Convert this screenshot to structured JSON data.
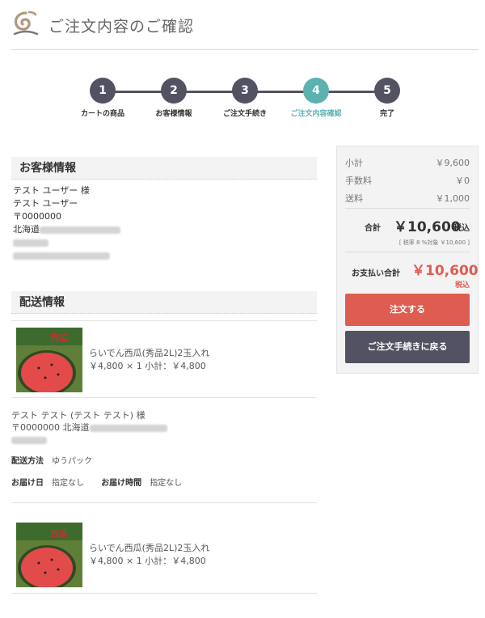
{
  "header": {
    "title": "ご注文内容のご確認"
  },
  "flow": {
    "steps": [
      {
        "num": "1",
        "label": "カートの商品"
      },
      {
        "num": "2",
        "label": "お客様情報"
      },
      {
        "num": "3",
        "label": "ご注文手続き"
      },
      {
        "num": "4",
        "label": "ご注文内容確認"
      },
      {
        "num": "5",
        "label": "完了"
      }
    ],
    "active_step": "4"
  },
  "customer": {
    "heading": "お客様情報",
    "name_kanji": "テスト ユーザー 様",
    "name_kana": "テスト ユーザー",
    "postal": "〒0000000",
    "prefecture": "北海道"
  },
  "shipping": {
    "heading": "配送情報",
    "items": [
      {
        "name": "らいでん西瓜(秀品2L)2玉入れ",
        "price_line": "￥4,800 × 1  小計：￥4,800"
      },
      {
        "name": "らいでん西瓜(秀品2L)2玉入れ",
        "price_line": "￥4,800 × 1  小計：￥4,800"
      }
    ],
    "recipient": "テスト テスト (テスト テスト) 様",
    "address": "〒0000000 北海道",
    "method_label": "配送方法",
    "method_value": "ゆうパック",
    "date_label": "お届け日",
    "date_value": "指定なし",
    "time_label": "お届け時間",
    "time_value": "指定なし"
  },
  "summary": {
    "subtotal_label": "小計",
    "subtotal_value": "￥9,600",
    "fee_label": "手数料",
    "fee_value": "￥0",
    "shipping_label": "送料",
    "shipping_value": "￥1,000",
    "total_label": "合計",
    "total_value": "￥10,600",
    "total_suffix": "税込",
    "tax_note": "[ 税率 8 %対象 ￥10,600 ]",
    "pay_label": "お支払い合計",
    "pay_value": "￥10,600",
    "pay_suffix": "税込",
    "order_button": "注文する",
    "back_button": "ご注文手続きに戻る"
  },
  "colors": {
    "dark": "#525263",
    "accent": "#5cb1b1",
    "order": "#de5d50"
  },
  "icons": {
    "logo": "swirl-logo-icon",
    "product": "watermelon-image"
  }
}
